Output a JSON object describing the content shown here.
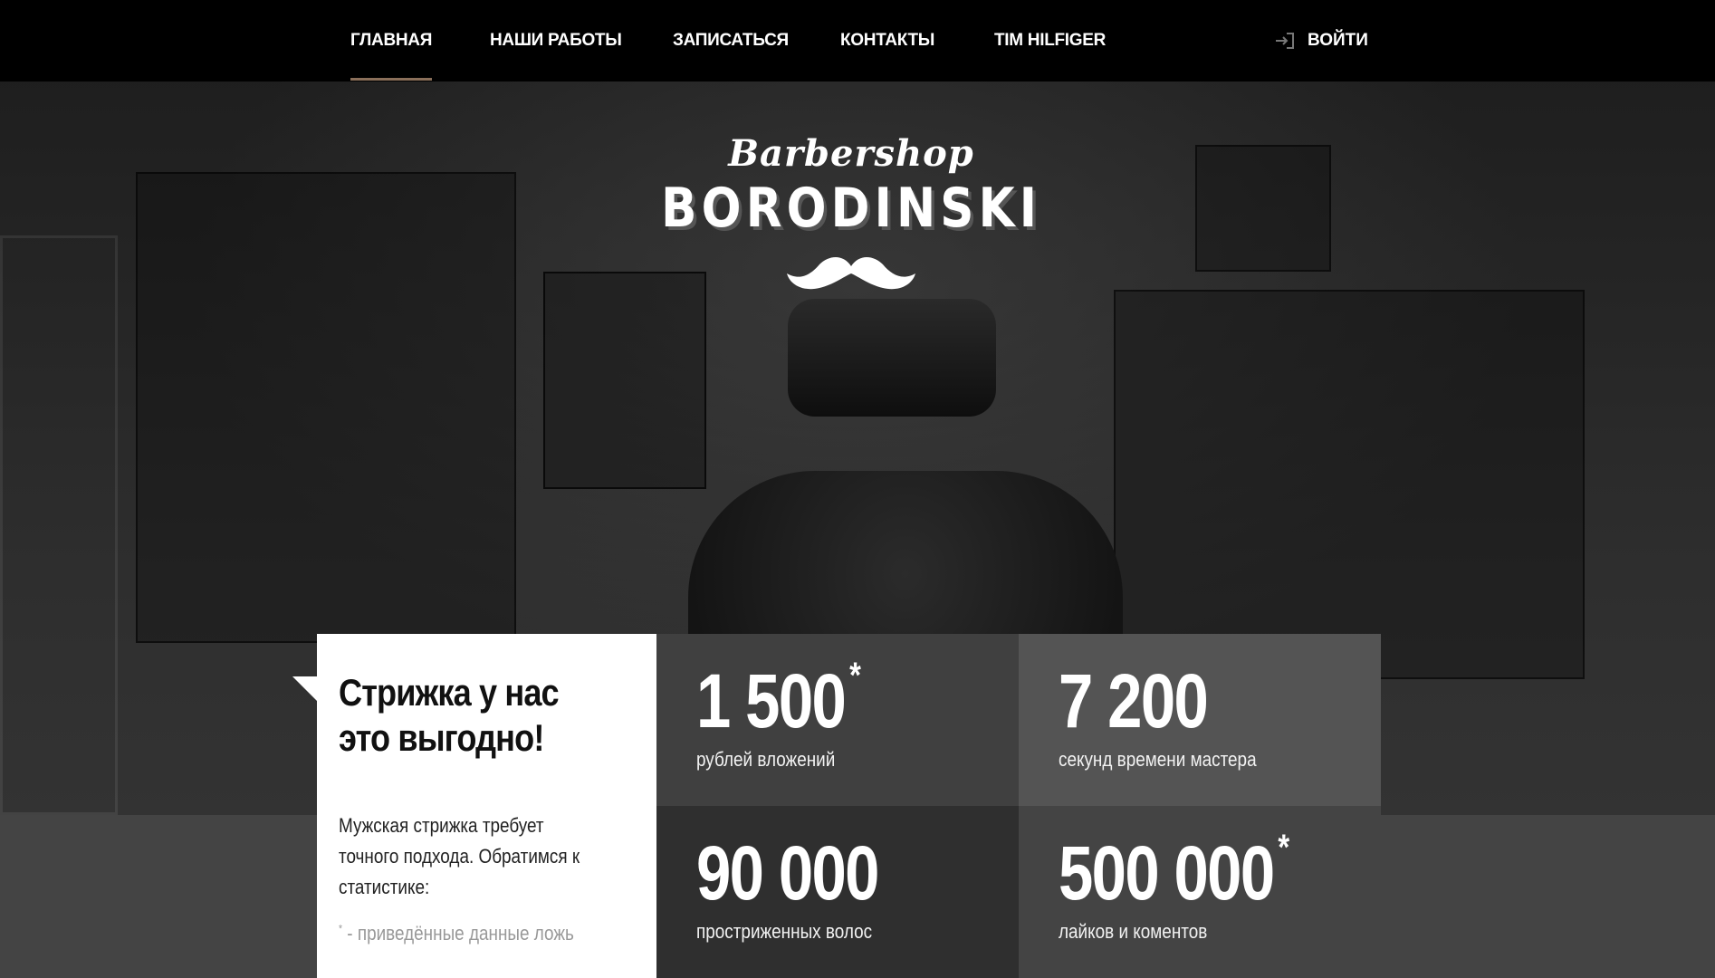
{
  "nav": {
    "items": [
      {
        "label": "ГЛАВНАЯ",
        "active": true
      },
      {
        "label": "НАШИ РАБОТЫ",
        "active": false
      },
      {
        "label": "ЗАПИСАТЬСЯ",
        "active": false
      },
      {
        "label": "КОНТАКТЫ",
        "active": false
      },
      {
        "label": "TIM HILFIGER",
        "active": false
      }
    ],
    "login_label": "ВОЙТИ",
    "login_icon": "login-icon",
    "active_color": "#8a6f5a"
  },
  "logo": {
    "script": "Barbershop",
    "name": "BORODINSKI",
    "mustache_icon": "mustache-icon"
  },
  "promo": {
    "title": "Стрижка у нас это выгодно!",
    "text": "Мужская стрижка требует точного подхода. Обратимся к статистике:",
    "note_star": "*",
    "note": " - приведённые данные ложь"
  },
  "stats": [
    {
      "value": "1 500",
      "star": "*",
      "label": "рублей вложений"
    },
    {
      "value": "7 200",
      "star": "",
      "label": "секунд времени мастера"
    },
    {
      "value": "90 000",
      "star": "",
      "label": "простриженных волос"
    },
    {
      "value": "500 000",
      "star": "*",
      "label": "лайков и коментов"
    }
  ]
}
